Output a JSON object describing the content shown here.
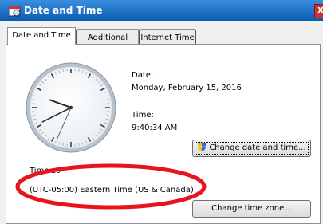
{
  "window": {
    "title": "Date and Time",
    "close_label": "X"
  },
  "tabs": [
    {
      "label": "Date and Time",
      "active": true
    },
    {
      "label": "Additional Clocks",
      "active": false
    },
    {
      "label": "Internet Time",
      "active": false
    }
  ],
  "datetime": {
    "date_label": "Date:",
    "date_value": "Monday, February 15, 2016",
    "time_label": "Time:",
    "time_value": "9:40:34 AM",
    "change_button_label": "Change date and time..."
  },
  "timezone": {
    "label": "Time zo",
    "value": "(UTC-05:00) Eastern Time (US & Canada)",
    "change_button_label": "Change time zone..."
  },
  "colors": {
    "title_bar": "#0b5cb0",
    "annotation": "#e8141c"
  },
  "clock": {
    "hour": 9,
    "minute": 40,
    "second": 34
  }
}
